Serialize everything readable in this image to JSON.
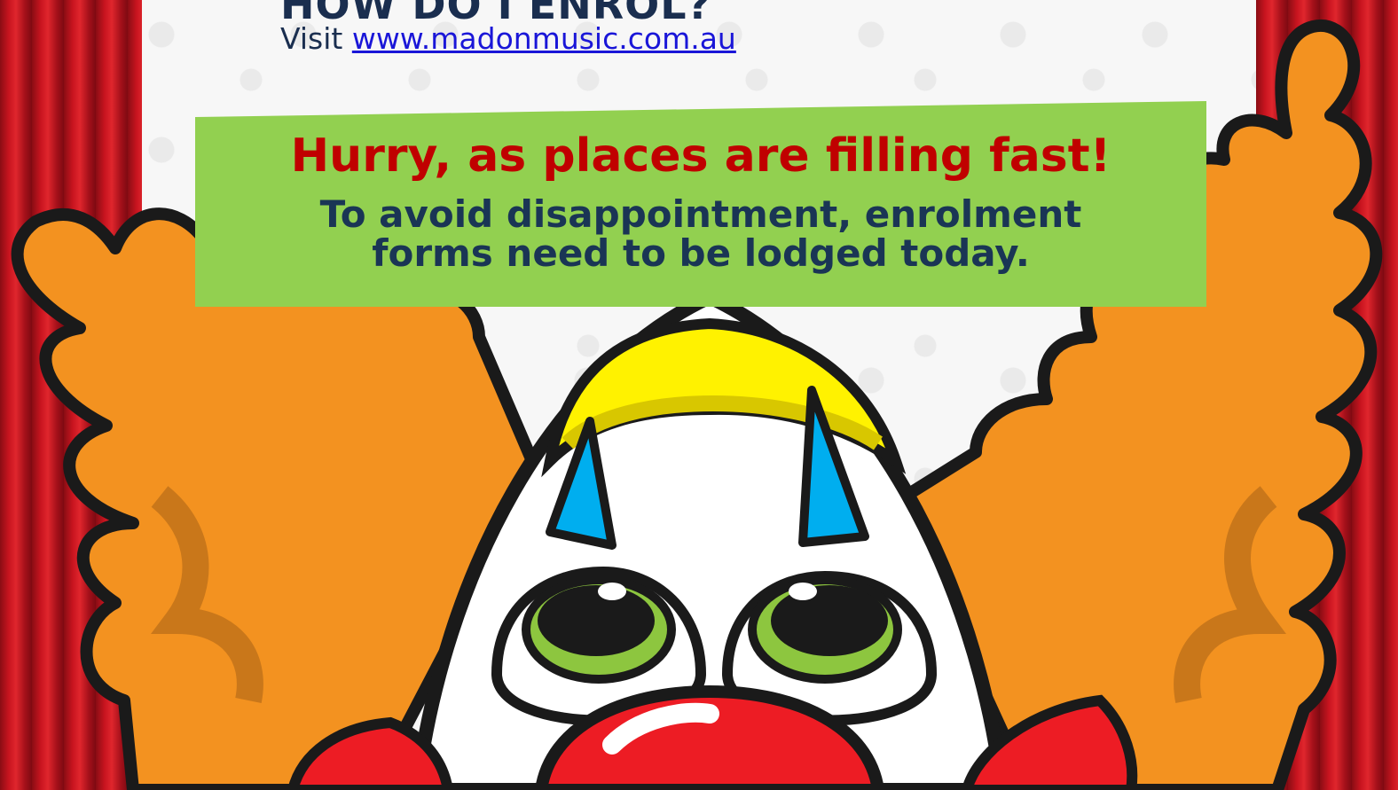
{
  "header": {
    "heading": "HOW DO I ENROL?",
    "visit_prefix": "Visit",
    "visit_link": "www.madonmusic.com.au"
  },
  "notice": {
    "title": "Hurry, as places are filling fast!",
    "body": "To avoid disappointment, enrolment forms need to be lodged today."
  },
  "colors": {
    "notice_background": "#92d050",
    "notice_title": "#c00000",
    "notice_body": "#1a3555",
    "link": "#1a16d8",
    "curtain": "#c8141f",
    "clown_hair": "#f39220",
    "clown_hat": "#fff200",
    "clown_nose": "#ed1c24",
    "clown_eye_ring": "#8dc63f"
  }
}
